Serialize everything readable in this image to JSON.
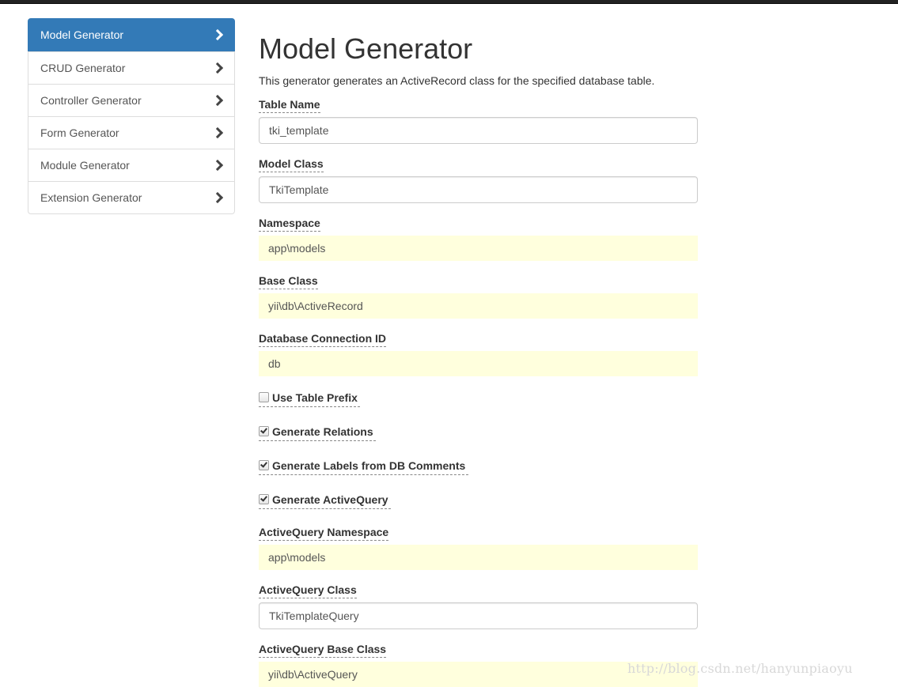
{
  "sidebar": {
    "items": [
      {
        "label": "Model Generator",
        "active": true
      },
      {
        "label": "CRUD Generator",
        "active": false
      },
      {
        "label": "Controller Generator",
        "active": false
      },
      {
        "label": "Form Generator",
        "active": false
      },
      {
        "label": "Module Generator",
        "active": false
      },
      {
        "label": "Extension Generator",
        "active": false
      }
    ]
  },
  "main": {
    "title": "Model Generator",
    "description": "This generator generates an ActiveRecord class for the specified database table.",
    "fields": {
      "table_name": {
        "label": "Table Name",
        "value": "tki_template"
      },
      "model_class": {
        "label": "Model Class",
        "value": "TkiTemplate"
      },
      "namespace": {
        "label": "Namespace",
        "value": "app\\models"
      },
      "base_class": {
        "label": "Base Class",
        "value": "yii\\db\\ActiveRecord"
      },
      "db_connection": {
        "label": "Database Connection ID",
        "value": "db"
      },
      "use_table_prefix": {
        "label": "Use Table Prefix",
        "checked": false
      },
      "generate_relations": {
        "label": "Generate Relations",
        "checked": true
      },
      "generate_labels": {
        "label": "Generate Labels from DB Comments",
        "checked": true
      },
      "generate_query": {
        "label": "Generate ActiveQuery",
        "checked": true
      },
      "query_namespace": {
        "label": "ActiveQuery Namespace",
        "value": "app\\models"
      },
      "query_class": {
        "label": "ActiveQuery Class",
        "value": "TkiTemplateQuery"
      },
      "query_base_class": {
        "label": "ActiveQuery Base Class",
        "value": "yii\\db\\ActiveQuery"
      }
    }
  },
  "watermark": "http://blog.csdn.net/hanyunpiaoyu",
  "colors": {
    "accent": "#337ab7",
    "readonly_bg": "#ffffdd"
  }
}
